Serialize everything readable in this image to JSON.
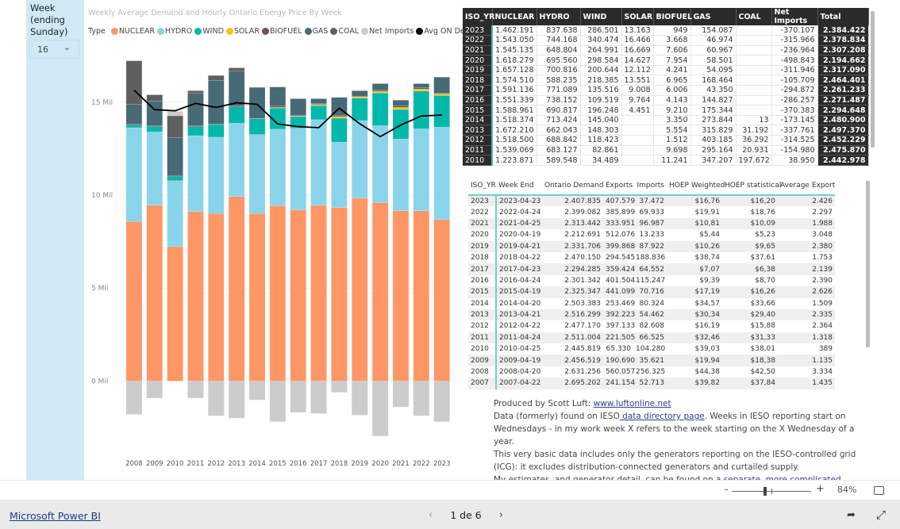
{
  "slicer": {
    "title": "Week (ending Sunday)",
    "value": "16"
  },
  "chart_data": {
    "type": "bar",
    "stacked": true,
    "title": "Weekly Average Demand and Hourly Ontario Energy Price By Week",
    "legend_title": "Type",
    "legend_position": "top-left",
    "categories": [
      "2008",
      "2009",
      "2010",
      "2011",
      "2012",
      "2013",
      "2014",
      "2015",
      "2016",
      "2017",
      "2018",
      "2019",
      "2020",
      "2021",
      "2022",
      "2023"
    ],
    "yticks": [
      "0 Mil",
      "5 Mil",
      "10 Mil",
      "15 Mil"
    ],
    "ylim": [
      -3.4,
      17.3
    ],
    "unit": "Mil",
    "grid": true,
    "series": [
      {
        "name": "NUCLEAR",
        "color": "#FE9666",
        "values": [
          8.58,
          9.46,
          7.23,
          9.12,
          9.01,
          9.93,
          9.01,
          9.43,
          9.2,
          9.45,
          9.33,
          9.84,
          9.6,
          9.16,
          9.16,
          8.68
        ]
      },
      {
        "name": "HYDRO",
        "color": "#8AD4EB",
        "values": [
          5.05,
          3.94,
          3.55,
          4.08,
          4.11,
          3.94,
          4.25,
          4.12,
          4.4,
          4.61,
          3.52,
          4.17,
          4.14,
          3.86,
          4.41,
          4.98
        ]
      },
      {
        "name": "WIND",
        "color": "#01B8AA",
        "values": [
          0.14,
          0.29,
          0.22,
          0.49,
          0.68,
          0.88,
          0.85,
          1.14,
          0.63,
          0.76,
          1.29,
          1.21,
          1.76,
          1.59,
          2.03,
          1.7
        ]
      },
      {
        "name": "SOLAR",
        "color": "#F2C80F",
        "values": [
          0,
          0,
          0,
          0,
          0,
          0,
          0,
          0.03,
          0.03,
          0.06,
          0.09,
          0.07,
          0.09,
          0.11,
          0.11,
          0.09
        ]
      },
      {
        "name": "BIOFUEL",
        "color": "#744A6F",
        "values": [
          0.06,
          0.04,
          0.05,
          0.05,
          0.03,
          0.05,
          0.03,
          0.07,
          0.05,
          0.04,
          0.05,
          0.04,
          0.06,
          0.08,
          0.07,
          0.05
        ]
      },
      {
        "name": "GAS",
        "color": "#466A76",
        "values": [
          1.05,
          1.32,
          2.04,
          1.76,
          2.35,
          1.87,
          1.65,
          1.03,
          0.88,
          0.27,
          0.98,
          0.29,
          0.35,
          0.31,
          0.22,
          0.85
        ]
      },
      {
        "name": "COAL",
        "color": "#5F5F5F",
        "values": [
          2.35,
          0.35,
          1.18,
          0.12,
          0.26,
          0.18,
          0.02,
          0,
          0,
          0,
          0,
          0,
          0,
          0,
          0,
          0
        ]
      },
      {
        "name": "Net Imports",
        "color": "#CCCCCC",
        "values": [
          -1.8,
          -0.92,
          0.24,
          -0.92,
          -1.87,
          -2.0,
          -1.02,
          -2.19,
          -1.69,
          -1.75,
          -0.61,
          -1.84,
          -2.96,
          -1.4,
          -1.87,
          -2.19
        ]
      }
    ],
    "line": {
      "name": "Avg ON Demand",
      "color": "#000000",
      "values": [
        15.65,
        14.6,
        14.54,
        14.94,
        14.72,
        14.97,
        14.89,
        13.83,
        13.69,
        13.63,
        14.68,
        13.84,
        13.15,
        13.77,
        14.26,
        14.31
      ]
    }
  },
  "supply_table": {
    "columns": [
      "ISO_YR",
      "NUCLEAR",
      "HYDRO",
      "WIND",
      "SOLAR",
      "BIOFUEL",
      "GAS",
      "COAL",
      "Net Imports",
      "Total"
    ],
    "rows": [
      [
        "2023",
        "1.462.191",
        "837.638",
        "286.501",
        "13.163",
        "949",
        "154.087",
        "",
        "-370.107",
        "2.384.422"
      ],
      [
        "2022",
        "1.543.050",
        "744.168",
        "340.474",
        "16.466",
        "3.668",
        "46.974",
        "",
        "-315.966",
        "2.378.834"
      ],
      [
        "2021",
        "1.545.135",
        "648.804",
        "264.991",
        "16.669",
        "7.606",
        "60.967",
        "",
        "-236.964",
        "2.307.208"
      ],
      [
        "2020",
        "1.618.279",
        "695.560",
        "298.584",
        "14.627",
        "7.954",
        "58.501",
        "",
        "-498.843",
        "2.194.662"
      ],
      [
        "2019",
        "1.657.128",
        "700.816",
        "200.644",
        "12.112",
        "4.241",
        "54.095",
        "",
        "-311.946",
        "2.317.090"
      ],
      [
        "2018",
        "1.574.510",
        "588.235",
        "218.385",
        "13.551",
        "6.965",
        "168.464",
        "",
        "-105.709",
        "2.464.401"
      ],
      [
        "2017",
        "1.591.136",
        "771.089",
        "135.516",
        "9.008",
        "6.006",
        "43.350",
        "",
        "-294.872",
        "2.261.233"
      ],
      [
        "2016",
        "1.551.339",
        "738.152",
        "109.519",
        "9.764",
        "4.143",
        "144.827",
        "",
        "-286.257",
        "2.271.487"
      ],
      [
        "2015",
        "1.588.961",
        "690.817",
        "196.248",
        "4.451",
        "9.210",
        "175.344",
        "",
        "-370.383",
        "2.294.648"
      ],
      [
        "2014",
        "1.518.374",
        "713.424",
        "145.040",
        "",
        "3.350",
        "273.844",
        "13",
        "-173.145",
        "2.480.900"
      ],
      [
        "2013",
        "1.672.210",
        "662.043",
        "148.303",
        "",
        "5.554",
        "315.829",
        "31.192",
        "-337.761",
        "2.497.370"
      ],
      [
        "2012",
        "1.518.500",
        "688.842",
        "118.423",
        "",
        "1.512",
        "403.185",
        "36.292",
        "-314.525",
        "2.452.229"
      ],
      [
        "2011",
        "1.539.069",
        "683.127",
        "82.861",
        "",
        "9.698",
        "295.164",
        "20.931",
        "-154.980",
        "2.475.870"
      ],
      [
        "2010",
        "1.223.871",
        "589.548",
        "34.489",
        "",
        "11.241",
        "347.207",
        "197.672",
        "38.950",
        "2.442.978"
      ]
    ]
  },
  "demand_table": {
    "columns": [
      "ISO_YR",
      "Week End",
      "Ontario Demand",
      "Exports",
      "Imports",
      "HOEP Weighted",
      "HOEP statistical",
      "Average Export"
    ],
    "rows": [
      [
        "2023",
        "2023-04-23",
        "2.407.835",
        "407.579",
        "37.472",
        "$16,76",
        "$16,20",
        "2.426"
      ],
      [
        "2022",
        "2022-04-24",
        "2.399.082",
        "385.899",
        "69.933",
        "$19,91",
        "$18,76",
        "2.297"
      ],
      [
        "2021",
        "2021-04-25",
        "2.313.442",
        "333.951",
        "96.987",
        "$10,81",
        "$10,09",
        "1.988"
      ],
      [
        "2020",
        "2020-04-19",
        "2.212.691",
        "512.076",
        "13.233",
        "$5,44",
        "$5,23",
        "3.048"
      ],
      [
        "2019",
        "2019-04-21",
        "2.331.706",
        "399.868",
        "87.922",
        "$10,26",
        "$9,65",
        "2.380"
      ],
      [
        "2018",
        "2018-04-22",
        "2.470.150",
        "294.545",
        "188.836",
        "$38,74",
        "$37,61",
        "1.753"
      ],
      [
        "2017",
        "2017-04-23",
        "2.294.285",
        "359.424",
        "64.552",
        "$7,07",
        "$6,38",
        "2.139"
      ],
      [
        "2016",
        "2016-04-24",
        "2.301.342",
        "401.504",
        "115.247",
        "$9,39",
        "$8,70",
        "2.390"
      ],
      [
        "2015",
        "2015-04-19",
        "2.325.347",
        "441.099",
        "70.716",
        "$17,19",
        "$16,26",
        "2.626"
      ],
      [
        "2014",
        "2014-04-20",
        "2.503.383",
        "253.469",
        "80.324",
        "$34,57",
        "$33,66",
        "1.509"
      ],
      [
        "2013",
        "2013-04-21",
        "2.516.299",
        "392.223",
        "54.462",
        "$30,34",
        "$29,40",
        "2.335"
      ],
      [
        "2012",
        "2012-04-22",
        "2.477.170",
        "397.133",
        "82.608",
        "$16,19",
        "$15,88",
        "2.364"
      ],
      [
        "2011",
        "2011-04-24",
        "2.511.004",
        "221.505",
        "66.525",
        "$32,46",
        "$31,33",
        "1.318"
      ],
      [
        "2010",
        "2010-04-25",
        "2.445.819",
        "65.330",
        "104.280",
        "$39,03",
        "$38,01",
        "389"
      ],
      [
        "2009",
        "2009-04-19",
        "2.456.519",
        "190.690",
        "35.621",
        "$19,94",
        "$18,38",
        "1.135"
      ],
      [
        "2008",
        "2008-04-20",
        "2.631.256",
        "560.057",
        "256.325",
        "$44,38",
        "$42,50",
        "3.334"
      ],
      [
        "2007",
        "2007-04-22",
        "2.695.202",
        "241.154",
        "52.713",
        "$39,82",
        "$37,84",
        "1.435"
      ]
    ]
  },
  "notes": {
    "l1_text": "Produced by Scott Luft: ",
    "l1_link": "www.luftonline.net",
    "l2_text": "Data (formerly) found on IESO",
    "l2_link": " data directory page",
    "l2_rest": ". Weeks in IESO reporting start on Wednesdays - in my work week X refers to the week starting on the X Wednesday of a year.",
    "l3_text": "This very basic data includes only the generators reporting on the IESO-controlled grid (ICG): it excludes distribution-connected generators and curtailed supply.",
    "l4_text": "My estimates, and generator detail, can be found on ",
    "l4_link": "a separate, more complicated, report",
    "l4_rest": "."
  },
  "zoom": {
    "minus": "-",
    "plus": "+",
    "value": "84%",
    "level_percent": 84
  },
  "footer": {
    "brand": "Microsoft Power BI",
    "page": "1 de 6",
    "prev": "‹",
    "next": "›",
    "share_icon": "share-icon",
    "expand_icon": "expand-icon"
  }
}
